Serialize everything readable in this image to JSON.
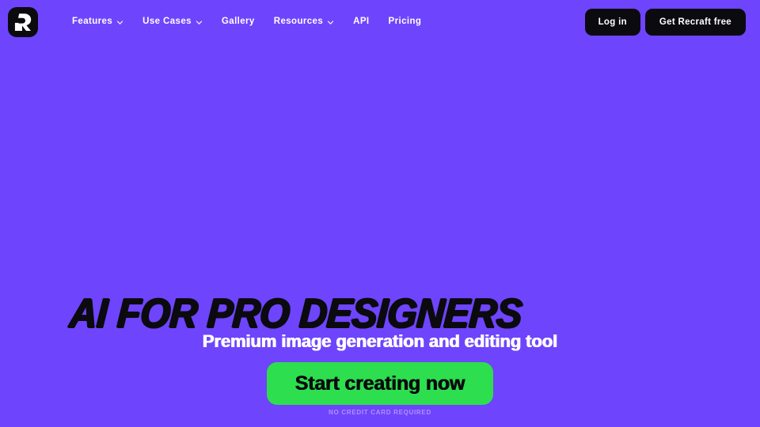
{
  "theme": {
    "background": "#6E44FD",
    "dark": "#0B0B0F",
    "accent_green": "#2DDE4E",
    "text_light": "#FFFFFF",
    "fineprint": "rgba(255,255,255,0.42)"
  },
  "header": {
    "logo": {
      "icon": "recraft-logo-icon",
      "alt": "Recraft"
    },
    "nav": [
      {
        "label": "Features",
        "has_dropdown": true,
        "icon": "chevron-down-icon"
      },
      {
        "label": "Use Cases",
        "has_dropdown": true,
        "icon": "chevron-down-icon"
      },
      {
        "label": "Gallery",
        "has_dropdown": false,
        "icon": ""
      },
      {
        "label": "Resources",
        "has_dropdown": true,
        "icon": "chevron-down-icon"
      },
      {
        "label": "API",
        "has_dropdown": false,
        "icon": ""
      },
      {
        "label": "Pricing",
        "has_dropdown": false,
        "icon": ""
      }
    ],
    "actions": {
      "login_label": "Log in",
      "signup_label": "Get Recraft free"
    }
  },
  "hero": {
    "headline": "AI FOR PRO DESIGNERS",
    "subheadline": "Premium image generation and editing tool",
    "cta_label": "Start creating now",
    "fineprint": "NO CREDIT CARD REQUIRED"
  }
}
